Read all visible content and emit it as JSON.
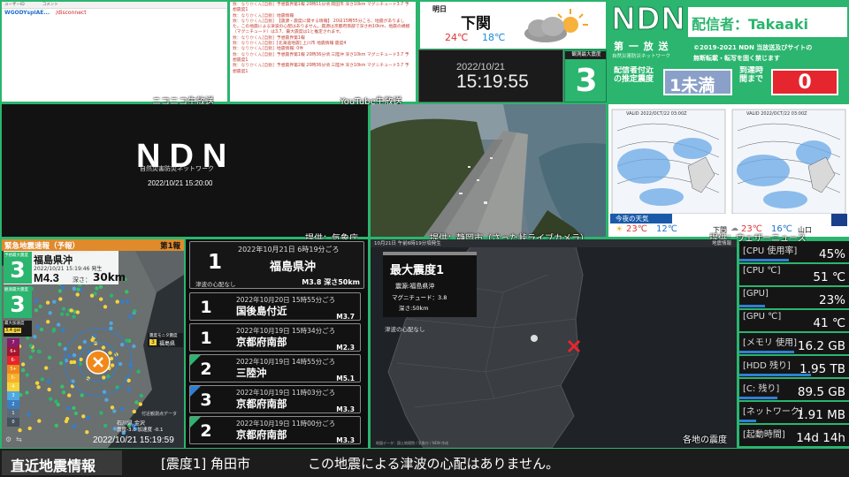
{
  "niconico_chat": {
    "headers": [
      "ユーザーID",
      "コメント"
    ],
    "rows": [
      {
        "user": "WGODYspIAE...",
        "msg": "/disconnect"
      }
    ]
  },
  "youtube_chat": {
    "lines": [
      {
        "who": "数：なりかくん[自動]",
        "text": "予想震界第1報 20時11分頃 岡田市 深さ10km マグニチュード3.7 予想震度1"
      },
      {
        "who": "数：なりかくん[自動]",
        "text": "地震情報"
      },
      {
        "who": "数：なりかくん[自動]",
        "text": "【震源・震度に関する情報】 20日15時55分ころ、地震がありました。この地震による津波の心配はありません。震源は京都府南部で深さ約10km、地震の規模（マグニチュード）は3.7、最大震度は1と推定されます。"
      },
      {
        "who": "数：なりかくん[自動]",
        "text": "予想震界第1報"
      },
      {
        "who": "数：なりかくん[自動]",
        "text": "[北海道地震] 上川市 地震情報 震度4"
      },
      {
        "who": "数：なりかくん[自動]",
        "text": "地震情報: 0件"
      },
      {
        "who": "数：なりかくん[自動]",
        "text": "予想震界第1報 20時36分頃 三陸沖 深さ10km マグニチュード3.7 予想震度1"
      },
      {
        "who": "数：なりかくん[自動]",
        "text": "予想震界第2報 20時36分頃 三陸沖 深さ10km マグニチュード3.7 予想震度1"
      }
    ]
  },
  "labels": {
    "niconico": "ニコニコ生放送",
    "youtube": "YouTube生放送",
    "credit_jma": "提供：気象庁",
    "credit_camera": "提供：静岡市（さった峠ライブカメラ）",
    "credit_weathernews": "提供：ウェザーニュース",
    "regional": "各地の震度"
  },
  "weather": {
    "day": "明日",
    "city": "下関",
    "high": "24℃",
    "low": "18℃"
  },
  "clock": {
    "date": "2022/10/21",
    "time": "15:19:55"
  },
  "max_intensity_box": {
    "label": "観測最大震度",
    "value": "3"
  },
  "ndn": {
    "logo": "NDN",
    "logo_sub": "自然災害防災ネットワーク",
    "broadcaster": "配信者：Takaaki",
    "station": "第 一 放 送",
    "copyright": "©2019-2021 NDN 当放送及びサイトの",
    "copyright2": "無断転載・転写を固く禁じます",
    "est_label": "配信者付近の推定震度",
    "est_value": "1未満",
    "arrival_label": "到達時間まで",
    "arrival_value": "0"
  },
  "ndn_screen": {
    "logo": "NDN",
    "sub": "自然災害防災ネットワーク",
    "time": "2022/10/21 15:20:00"
  },
  "weather_chart": {
    "left_title": "VALID 2022/OCT/22 03:00Z",
    "right_title": "VALID 2022/OCT/22 03:00Z",
    "tonight": "今夜の天気",
    "city1": "下関",
    "temp1_hi": "23℃",
    "temp1_lo": "12℃",
    "city2": "山口",
    "temp2_hi": "23℃",
    "temp2_lo": "16℃"
  },
  "eew": {
    "title": "緊急地震速報（予報）",
    "report": "第1報",
    "pred_label": "予想最大震度",
    "pred_value": "3",
    "obs_label": "観測最大震度",
    "obs_value": "3",
    "region": "福島県沖",
    "issued": "2022/10/21 15:19:46 発生",
    "magnitude": "M4.3",
    "depth_label": "深さ：",
    "depth_value": "30km",
    "accel_label": "最大加速度",
    "accel_value": "3.4 gal",
    "monitor_label": "震度モニタ震度",
    "monitor_value": "3",
    "monitor_place": "福島県",
    "station_label": "付近観測点データ",
    "station_name": "石川県 金沢",
    "station_values": "震度-3.0 加速度 -0.1",
    "timestamp": "2022/10/21 15:19:59",
    "scale": [
      "7",
      "6+",
      "6-",
      "5+",
      "5-",
      "4",
      "3",
      "2",
      "1",
      "0"
    ]
  },
  "quake_latest": {
    "datetime": "2022年10月21日 6時19分ごろ",
    "intensity": "1",
    "place": "福島県沖",
    "tsunami": "津波の心配なし",
    "mag_depth": "M3.8 深さ50km"
  },
  "quake_list": [
    {
      "datetime": "2022年10月20日 15時55分ごろ",
      "intensity": "1",
      "place": "国後島付近",
      "mag": "M3.7",
      "accent": ""
    },
    {
      "datetime": "2022年10月19日 15時34分ごろ",
      "intensity": "1",
      "place": "京都府南部",
      "mag": "M2.3",
      "accent": ""
    },
    {
      "datetime": "2022年10月19日 14時55分ごろ",
      "intensity": "2",
      "place": "三陸沖",
      "mag": "M5.1",
      "accent": "#2bb56e"
    },
    {
      "datetime": "2022年10月19日 11時03分ごろ",
      "intensity": "3",
      "place": "京都府南部",
      "mag": "M3.3",
      "accent": "#2f7fd1"
    },
    {
      "datetime": "2022年10月19日 11時00分ごろ",
      "intensity": "2",
      "place": "京都府南部",
      "mag": "M3.3",
      "accent": "#2bb56e"
    }
  ],
  "map_panel": {
    "header": "10月21日 午前6時19分頃発生",
    "header_right": "地震情報",
    "title": "最大震度1",
    "epicenter": "震源:福島県沖",
    "magnitude": "マグニチュード：3.8",
    "depth": "深さ:50km",
    "tsunami": "津波の心配なし",
    "footer": "地図データ：国土地理院 / 気象庁 / NDN 作成"
  },
  "pc_stats": [
    {
      "key": "[CPU 使用率]",
      "value": "45%",
      "bar": 0.45
    },
    {
      "key": "[CPU ℃]",
      "value": "51 ℃",
      "bar": 0
    },
    {
      "key": "[GPU]",
      "value": "23%",
      "bar": 0.23
    },
    {
      "key": "[GPU ℃]",
      "value": "41 ℃",
      "bar": 0
    },
    {
      "key": "[メモリ 使用]",
      "value": "16.2 GB",
      "bar": 0.5
    },
    {
      "key": "[HDD 残り]",
      "value": "1.95 TB",
      "bar": 0.65
    },
    {
      "key": "[C: 残り]",
      "value": "89.5 GB",
      "bar": 0.35
    },
    {
      "key": "[ネットワーク]",
      "value": "1.91 MB",
      "bar": 0.15
    },
    {
      "key": "[起動時間]",
      "value": "14d 14h",
      "bar": 0
    }
  ],
  "ticker": {
    "label": "直近地震情報",
    "item1": "[震度1] 角田市",
    "item2": "この地震による津波の心配はありません。"
  },
  "colors": {
    "brand": "#2bb56e",
    "alert": "#e5262e",
    "accent": "#2f7fd1"
  }
}
